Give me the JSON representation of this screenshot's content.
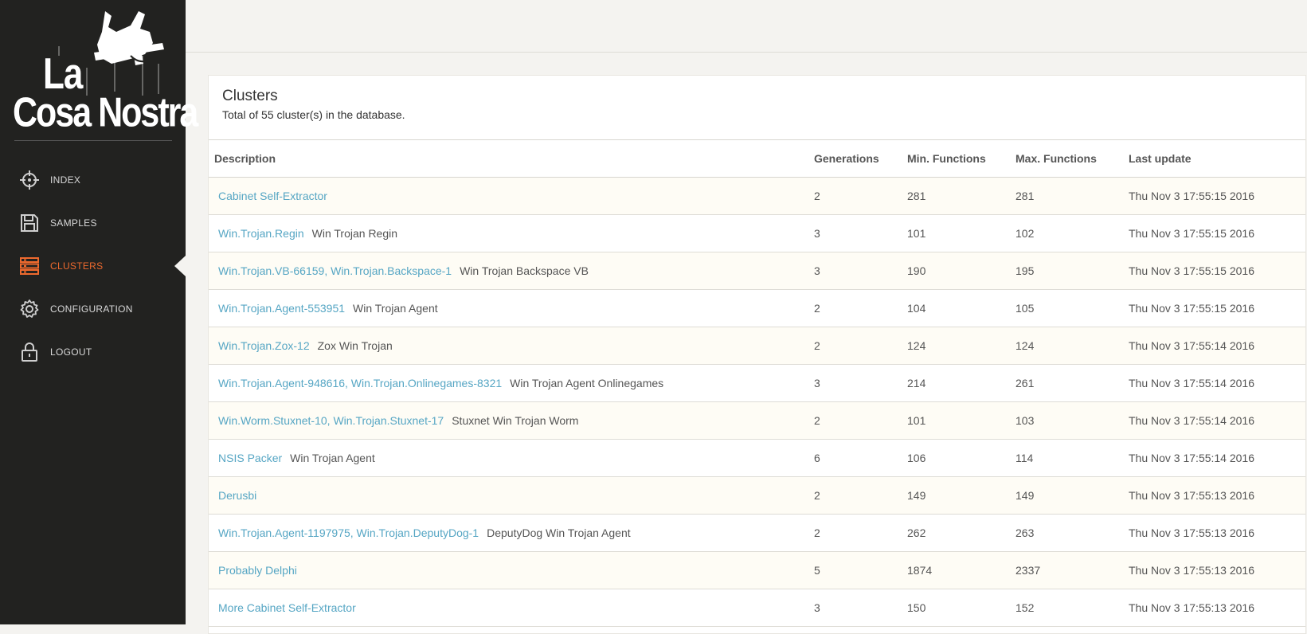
{
  "app": {
    "logo": {
      "line1": "La",
      "line2": "Cosa Nostra"
    }
  },
  "nav": {
    "items": [
      {
        "label": "INDEX",
        "icon": "crosshair-icon",
        "active": false
      },
      {
        "label": "SAMPLES",
        "icon": "floppy-disk-icon",
        "active": false
      },
      {
        "label": "CLUSTERS",
        "icon": "server-stack-icon",
        "active": true
      },
      {
        "label": "CONFIGURATION",
        "icon": "gear-icon",
        "active": false
      },
      {
        "label": "LOGOUT",
        "icon": "lock-icon",
        "active": false
      }
    ]
  },
  "colors": {
    "sidebar_bg": "#222220",
    "accent": "#ef6a2e",
    "link": "#56a6c4",
    "page_bg": "#f4f3f0"
  },
  "panel": {
    "title": "Clusters",
    "subtitle": "Total of 55 cluster(s) in the database."
  },
  "table": {
    "headers": {
      "description": "Description",
      "generations": "Generations",
      "min": "Min. Functions",
      "max": "Max. Functions",
      "updated": "Last update"
    },
    "rows": [
      {
        "name": "Cabinet Self-Extractor",
        "tag": "",
        "generations": "2",
        "min": "281",
        "max": "281",
        "updated": "Thu Nov 3 17:55:15 2016"
      },
      {
        "name": "Win.Trojan.Regin",
        "tag": "Win Trojan Regin",
        "generations": "3",
        "min": "101",
        "max": "102",
        "updated": "Thu Nov 3 17:55:15 2016"
      },
      {
        "name": "Win.Trojan.VB-66159, Win.Trojan.Backspace-1",
        "tag": "Win Trojan Backspace VB",
        "generations": "3",
        "min": "190",
        "max": "195",
        "updated": "Thu Nov 3 17:55:15 2016"
      },
      {
        "name": "Win.Trojan.Agent-553951",
        "tag": "Win Trojan Agent",
        "generations": "2",
        "min": "104",
        "max": "105",
        "updated": "Thu Nov 3 17:55:15 2016"
      },
      {
        "name": "Win.Trojan.Zox-12",
        "tag": "Zox Win Trojan",
        "generations": "2",
        "min": "124",
        "max": "124",
        "updated": "Thu Nov 3 17:55:14 2016"
      },
      {
        "name": "Win.Trojan.Agent-948616, Win.Trojan.Onlinegames-8321",
        "tag": "Win Trojan Agent Onlinegames",
        "generations": "3",
        "min": "214",
        "max": "261",
        "updated": "Thu Nov 3 17:55:14 2016"
      },
      {
        "name": "Win.Worm.Stuxnet-10, Win.Trojan.Stuxnet-17",
        "tag": "Stuxnet Win Trojan Worm",
        "generations": "2",
        "min": "101",
        "max": "103",
        "updated": "Thu Nov 3 17:55:14 2016"
      },
      {
        "name": "NSIS Packer",
        "tag": "Win Trojan Agent",
        "generations": "6",
        "min": "106",
        "max": "114",
        "updated": "Thu Nov 3 17:55:14 2016"
      },
      {
        "name": "Derusbi",
        "tag": "",
        "generations": "2",
        "min": "149",
        "max": "149",
        "updated": "Thu Nov 3 17:55:13 2016"
      },
      {
        "name": "Win.Trojan.Agent-1197975, Win.Trojan.DeputyDog-1",
        "tag": "DeputyDog Win Trojan Agent",
        "generations": "2",
        "min": "262",
        "max": "263",
        "updated": "Thu Nov 3 17:55:13 2016"
      },
      {
        "name": "Probably Delphi",
        "tag": "",
        "generations": "5",
        "min": "1874",
        "max": "2337",
        "updated": "Thu Nov 3 17:55:13 2016"
      },
      {
        "name": "More Cabinet Self-Extractor",
        "tag": "",
        "generations": "3",
        "min": "150",
        "max": "152",
        "updated": "Thu Nov 3 17:55:13 2016"
      }
    ]
  }
}
